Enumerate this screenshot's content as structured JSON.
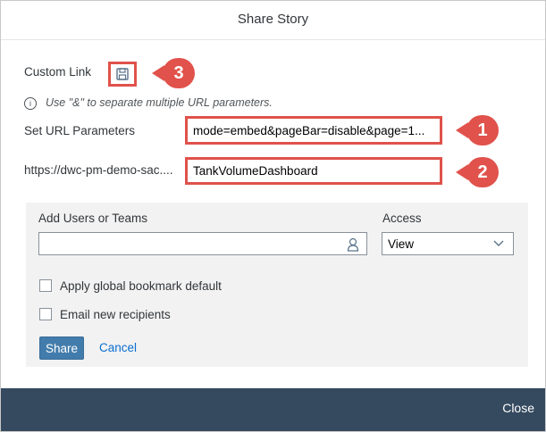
{
  "dialog": {
    "title": "Share Story",
    "custom_link_label": "Custom Link",
    "hint": "Use \"&\" to separate multiple URL parameters.",
    "url_params_label": "Set URL Parameters",
    "url_params_value": "mode=embed&pageBar=disable&page=1...",
    "base_url": "https://dwc-pm-demo-sac....",
    "story_name_value": "TankVolumeDashboard",
    "callouts": [
      "1",
      "2",
      "3"
    ]
  },
  "panel": {
    "users_label": "Add Users or Teams",
    "users_placeholder": "",
    "access_label": "Access",
    "access_value": "View",
    "apply_bookmark_label": "Apply global bookmark default",
    "email_label": "Email new recipients",
    "share_label": "Share",
    "cancel_label": "Cancel"
  },
  "footer": {
    "close_label": "Close"
  },
  "colors": {
    "annotation": "#e0524b",
    "primary": "#427cac",
    "footer": "#354a5f"
  }
}
